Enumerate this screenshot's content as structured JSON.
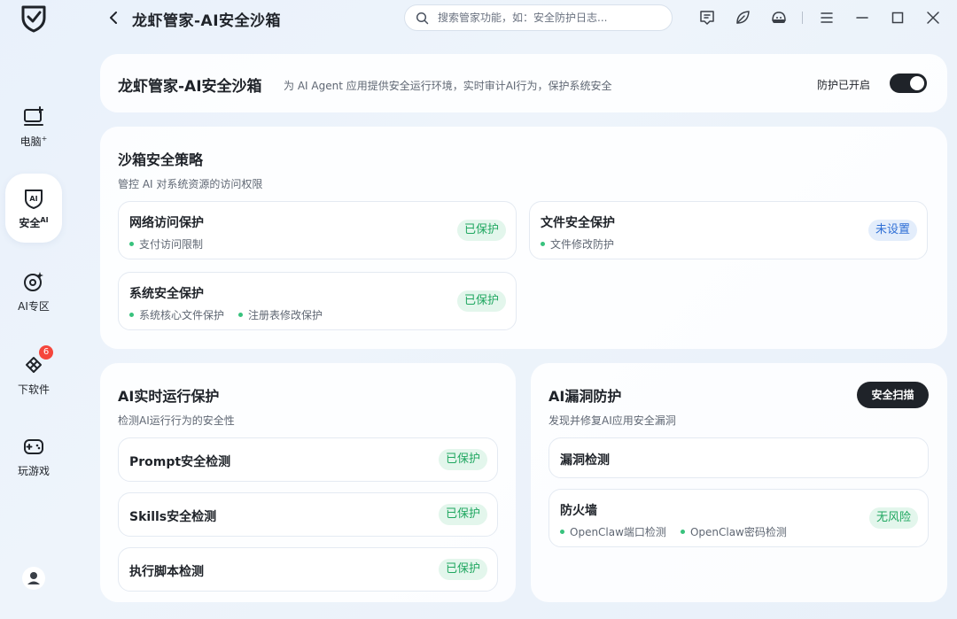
{
  "app": {
    "title": "龙虾管家-AI安全沙箱"
  },
  "search": {
    "placeholder": "搜索管家功能，如：安全防护日志..."
  },
  "sidebar": {
    "items": [
      {
        "label": "电脑",
        "sup": "+",
        "icon": "computer-icon"
      },
      {
        "label": "安全",
        "sup": "AI",
        "icon": "ai-shield-icon",
        "active": true
      },
      {
        "label": "AI专区",
        "icon": "ai-zone-icon"
      },
      {
        "label": "下软件",
        "icon": "software-icon",
        "badge": "6"
      },
      {
        "label": "玩游戏",
        "icon": "gamepad-icon"
      }
    ]
  },
  "header": {
    "title": "龙虾管家-AI安全沙箱",
    "description": "为 AI Agent 应用提供安全运行环境，实时审计AI行为，保护系统安全",
    "status": "防护已开启",
    "toggle_on": true
  },
  "policy": {
    "title": "沙箱安全策略",
    "subtitle": "管控 AI 对系统资源的访问权限",
    "items": [
      {
        "title": "网络访问保护",
        "tags": [
          "支付访问限制"
        ],
        "status": "已保护"
      },
      {
        "title": "文件安全保护",
        "tags": [
          "文件修改防护"
        ],
        "status": "未设置"
      },
      {
        "title": "系统安全保护",
        "tags": [
          "系统核心文件保护",
          "注册表修改保护"
        ],
        "status": "已保护"
      }
    ]
  },
  "runtime": {
    "title": "AI实时运行保护",
    "subtitle": "检测AI运行行为的安全性",
    "items": [
      {
        "title": "Prompt安全检测",
        "status": "已保护"
      },
      {
        "title": "Skills安全检测",
        "status": "已保护"
      },
      {
        "title": "执行脚本检测",
        "status": "已保护"
      }
    ]
  },
  "vuln": {
    "title": "AI漏洞防护",
    "subtitle": "发现并修复AI应用安全漏洞",
    "scan_button": "安全扫描",
    "items": [
      {
        "title": "漏洞检测"
      },
      {
        "title": "防火墙",
        "tags": [
          "OpenClaw端口检测",
          "OpenClaw密码检测"
        ],
        "status": "无风险"
      }
    ]
  },
  "colors": {
    "accent_dark": "#1f2329",
    "protected_green": "#1fa760",
    "unset_blue": "#2f6fd6",
    "badge_red": "#f5463c"
  }
}
